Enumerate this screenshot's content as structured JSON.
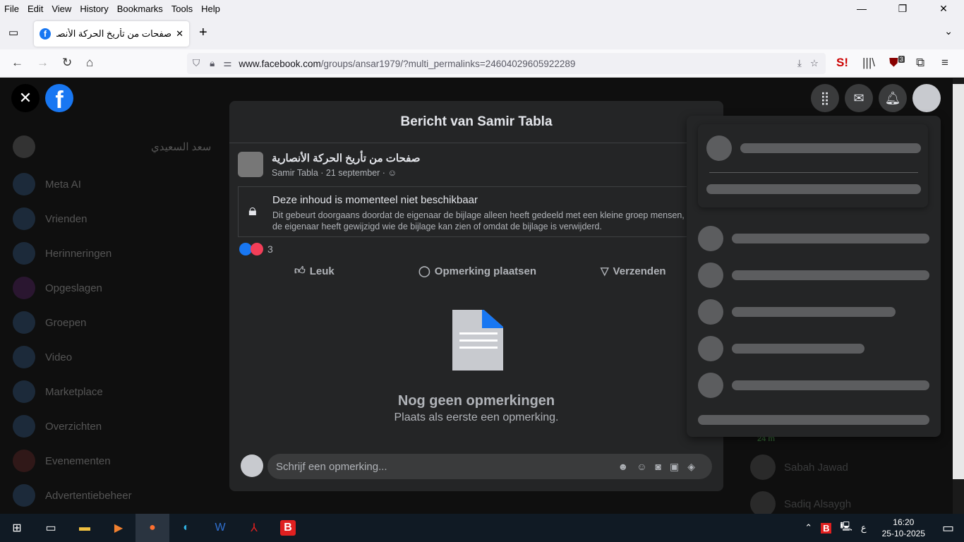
{
  "menu": [
    "File",
    "Edit",
    "View",
    "History",
    "Bookmarks",
    "Tools",
    "Help"
  ],
  "tab": {
    "title": "صفحات من تأريخ الحركة الأنصارية"
  },
  "url": {
    "domain": "www.facebook.com",
    "path": "/groups/ansar1979/?multi_permalinks=24604029605922289"
  },
  "ext_badge": "3",
  "sidebar": {
    "profile": "سعد السعيدي",
    "items": [
      "Meta AI",
      "Vrienden",
      "Herinneringen",
      "Opgeslagen",
      "Groepen",
      "Video",
      "Marketplace",
      "Overzichten",
      "Evenementen",
      "Advertentiebeheer"
    ]
  },
  "modal": {
    "title": "Bericht van Samir Tabla",
    "group": "صفحات من تأريخ الحركة الأنصارية",
    "author": "Samir Tabla",
    "date": "21 september",
    "unavailable_title": "Deze inhoud is momenteel niet beschikbaar",
    "unavailable_text": "Dit gebeurt doorgaans doordat de eigenaar de bijlage alleen heeft gedeeld met een kleine groep mensen, de eigenaar heeft gewijzigd wie de bijlage kan zien of omdat de bijlage is verwijderd.",
    "reactions": "3",
    "like": "Leuk",
    "comment": "Opmerking plaatsen",
    "send": "Verzenden",
    "empty_title": "Nog geen opmerkingen",
    "empty_sub": "Plaats als eerste een opmerking.",
    "comment_placeholder": "Schrijf een opmerking..."
  },
  "contacts": [
    {
      "name": "Sabah Jawad"
    },
    {
      "name": "Sadiq Alsaygh"
    }
  ],
  "contact_time": "24 m",
  "clock": {
    "time": "16:20",
    "date": "25-10-2025"
  },
  "lang": "ع"
}
